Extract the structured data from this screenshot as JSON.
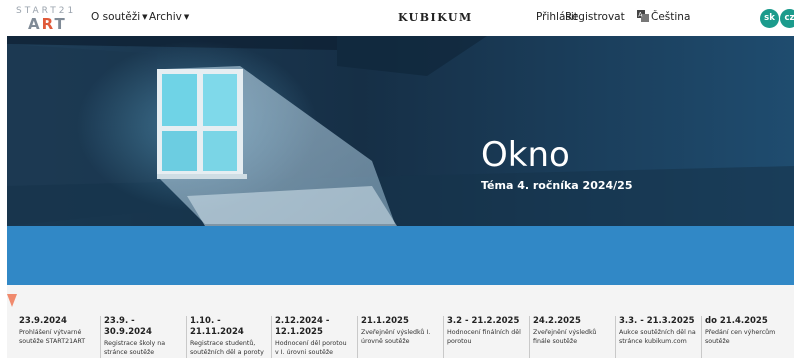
{
  "header": {
    "logo_top": "START21",
    "logo_bottom_left": "A",
    "logo_bottom_mid": "R",
    "logo_bottom_right": "T",
    "nav": [
      {
        "label": "O soutěži"
      },
      {
        "label": "Archiv"
      }
    ],
    "brand": "KUBIKUM",
    "login": "Přihlásit",
    "register": "Registrovat",
    "language": "Čeština",
    "flags": [
      "sk",
      "cz"
    ]
  },
  "hero": {
    "title": "Okno",
    "subtitle": "Téma 4. ročníka 2024/25"
  },
  "timeline": {
    "steps": [
      {
        "date": "23.9.2024",
        "desc": "Prohlášení výtvarné soutěže START21ART"
      },
      {
        "date": "23.9. - 30.9.2024",
        "desc": "Registrace školy na stránce soutěže"
      },
      {
        "date": "1.10. - 21.11.2024",
        "desc": "Registrace studentů, soutěžních děl a poroty"
      },
      {
        "date": "2.12.2024 - 12.1.2025",
        "desc": "Hodnocení děl porotou v I. úrovni soutěže"
      },
      {
        "date": "21.1.2025",
        "desc": "Zveřejnění výsledků I. úrovně soutěže"
      },
      {
        "date": "3.2 - 21.2.2025",
        "desc": "Hodnocení finálních děl porotou"
      },
      {
        "date": "24.2.2025",
        "desc": "Zveřejnění výsledků finále soutěže"
      },
      {
        "date": "3.3. - 21.3.2025",
        "desc": "Aukce soutěžních děl na stránce kubikum.com"
      },
      {
        "date": "do 21.4.2025",
        "desc": "Předání cen výhercům soutěže"
      }
    ]
  },
  "colors": {
    "band": "#3188c6",
    "accent": "#1b9b8c",
    "marker": "#f08a6d"
  }
}
